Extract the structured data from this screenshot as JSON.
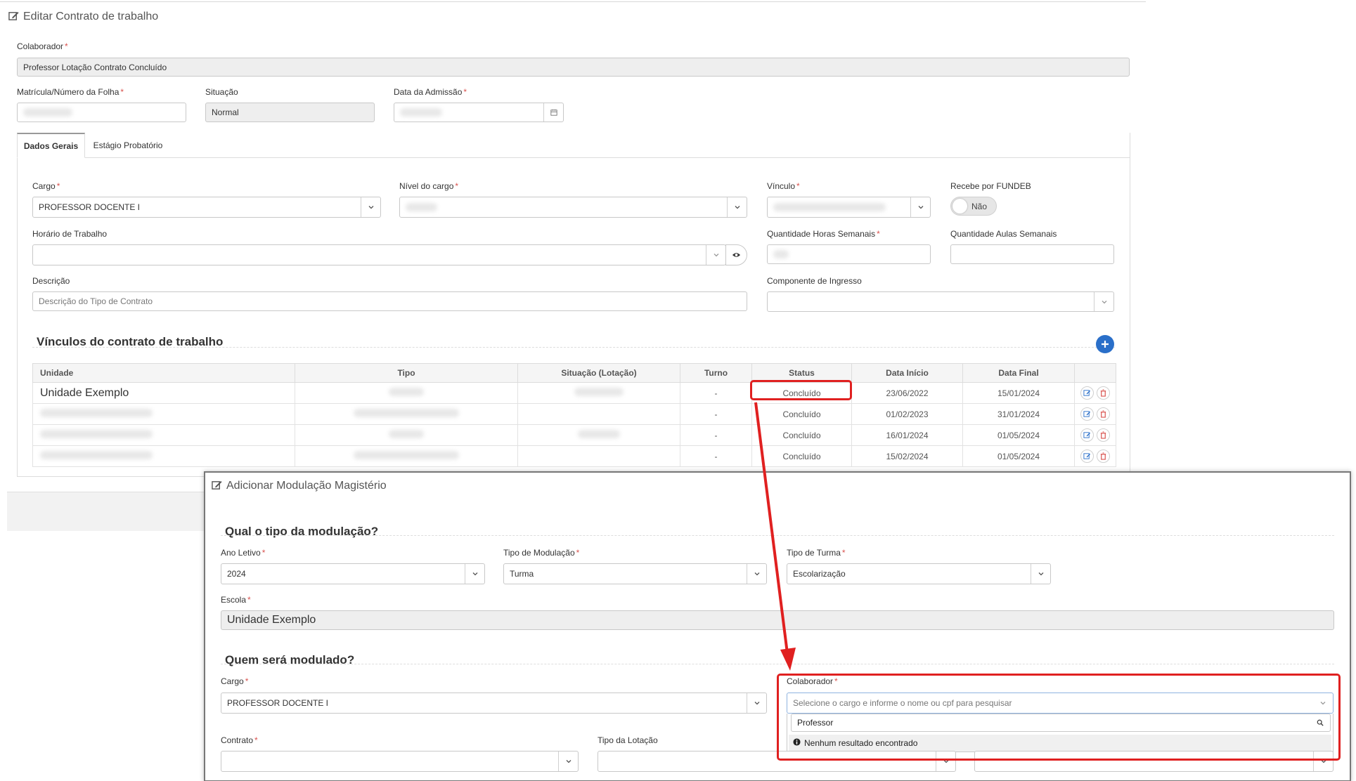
{
  "main": {
    "title": "Editar Contrato de trabalho",
    "colaborador": {
      "label": "Colaborador",
      "value": "Professor Lotação Contrato Concluído"
    },
    "matricula": {
      "label": "Matrícula/Número da Folha"
    },
    "situacao": {
      "label": "Situação",
      "value": "Normal"
    },
    "data_admissao": {
      "label": "Data da Admissão"
    },
    "tabs": [
      {
        "label": "Dados Gerais",
        "active": true
      },
      {
        "label": "Estágio Probatório",
        "active": false
      }
    ],
    "cargo": {
      "label": "Cargo",
      "value": "PROFESSOR DOCENTE I"
    },
    "nivel_cargo": {
      "label": "Nível do cargo"
    },
    "vinculo": {
      "label": "Vínculo"
    },
    "fundeb": {
      "label": "Recebe por FUNDEB",
      "value": "Não"
    },
    "horario": {
      "label": "Horário de Trabalho"
    },
    "qtd_horas": {
      "label": "Quantidade Horas Semanais"
    },
    "qtd_aulas": {
      "label": "Quantidade Aulas Semanais"
    },
    "descricao": {
      "label": "Descrição",
      "placeholder": "Descrição do Tipo de Contrato"
    },
    "componente": {
      "label": "Componente de Ingresso"
    },
    "vinculos": {
      "title": "Vínculos do contrato de trabalho",
      "columns": [
        "Unidade",
        "Tipo",
        "Situação (Lotação)",
        "Turno",
        "Status",
        "Data Início",
        "Data Final"
      ],
      "rows": [
        {
          "unidade": "Unidade Exemplo",
          "turno": "-",
          "status": "Concluído",
          "inicio": "23/06/2022",
          "final": "15/01/2024"
        },
        {
          "unidade": "",
          "turno": "-",
          "status": "Concluído",
          "inicio": "01/02/2023",
          "final": "31/01/2024"
        },
        {
          "unidade": "",
          "turno": "-",
          "status": "Concluído",
          "inicio": "16/01/2024",
          "final": "01/05/2024"
        },
        {
          "unidade": "",
          "turno": "-",
          "status": "Concluído",
          "inicio": "15/02/2024",
          "final": "01/05/2024"
        }
      ]
    }
  },
  "modal": {
    "title": "Adicionar Modulação Magistério",
    "section1": "Qual o tipo da modulação?",
    "ano_letivo": {
      "label": "Ano Letivo",
      "value": "2024"
    },
    "tipo_modulacao": {
      "label": "Tipo de Modulação",
      "value": "Turma"
    },
    "tipo_turma": {
      "label": "Tipo de Turma",
      "value": "Escolarização"
    },
    "escola": {
      "label": "Escola",
      "value": "Unidade Exemplo"
    },
    "section2": "Quem será modulado?",
    "cargo": {
      "label": "Cargo",
      "value": "PROFESSOR DOCENTE I"
    },
    "colaborador": {
      "label": "Colaborador",
      "placeholder": "Selecione o cargo e informe o nome ou cpf para pesquisar",
      "search_value": "Professor",
      "no_results": "Nenhum resultado encontrado"
    },
    "contrato": {
      "label": "Contrato"
    },
    "tipo_lotacao": {
      "label": "Tipo da Lotação"
    }
  },
  "colors": {
    "required": "#d9534f",
    "highlight": "#e02020",
    "add_button": "#2a6fc9"
  },
  "icons": [
    "edit-icon",
    "calendar-icon",
    "chevron-down-icon",
    "eye-icon",
    "plus-icon",
    "pencil-icon",
    "trash-icon",
    "search-icon",
    "info-icon",
    "arrow-icon"
  ]
}
